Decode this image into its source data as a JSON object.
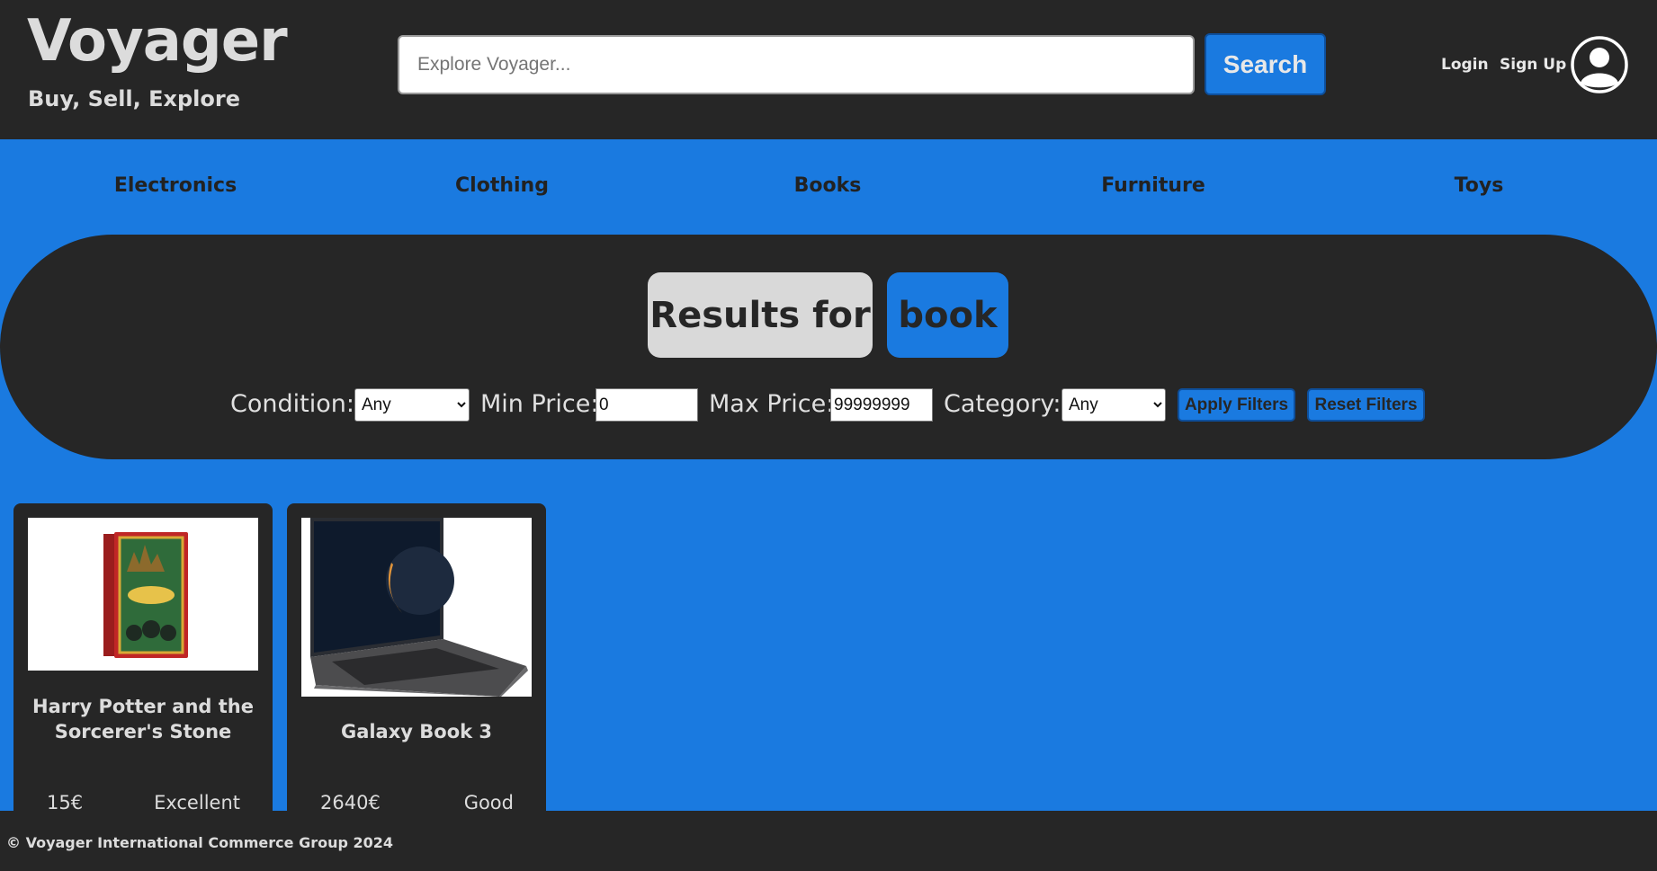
{
  "brand": {
    "title": "Voyager",
    "tagline": "Buy, Sell, Explore"
  },
  "search": {
    "placeholder": "Explore Voyager...",
    "value": "",
    "button_label": "Search"
  },
  "auth": {
    "login_label": "Login",
    "signup_label": "Sign Up"
  },
  "categories": [
    "Electronics",
    "Clothing",
    "Books",
    "Furniture",
    "Toys"
  ],
  "results": {
    "label": "Results for",
    "query": "book"
  },
  "filters": {
    "condition_label": "Condition:",
    "condition_value": "Any",
    "min_price_label": "Min Price:",
    "min_price_value": "0",
    "max_price_label": "Max Price:",
    "max_price_value": "99999999",
    "category_label": "Category:",
    "category_value": "Any",
    "apply_label": "Apply Filters",
    "reset_label": "Reset Filters"
  },
  "products": [
    {
      "title_line1": "Harry Potter and the",
      "title_line2": "Sorcerer's Stone",
      "price": "15€",
      "condition": "Excellent"
    },
    {
      "title": "Galaxy Book 3",
      "price": "2640€",
      "condition": "Good"
    }
  ],
  "footer": {
    "text": "© Voyager International Commerce Group 2024"
  },
  "colors": {
    "accent": "#1a7ae0",
    "dark": "#262626",
    "light": "#dcdcdc"
  }
}
